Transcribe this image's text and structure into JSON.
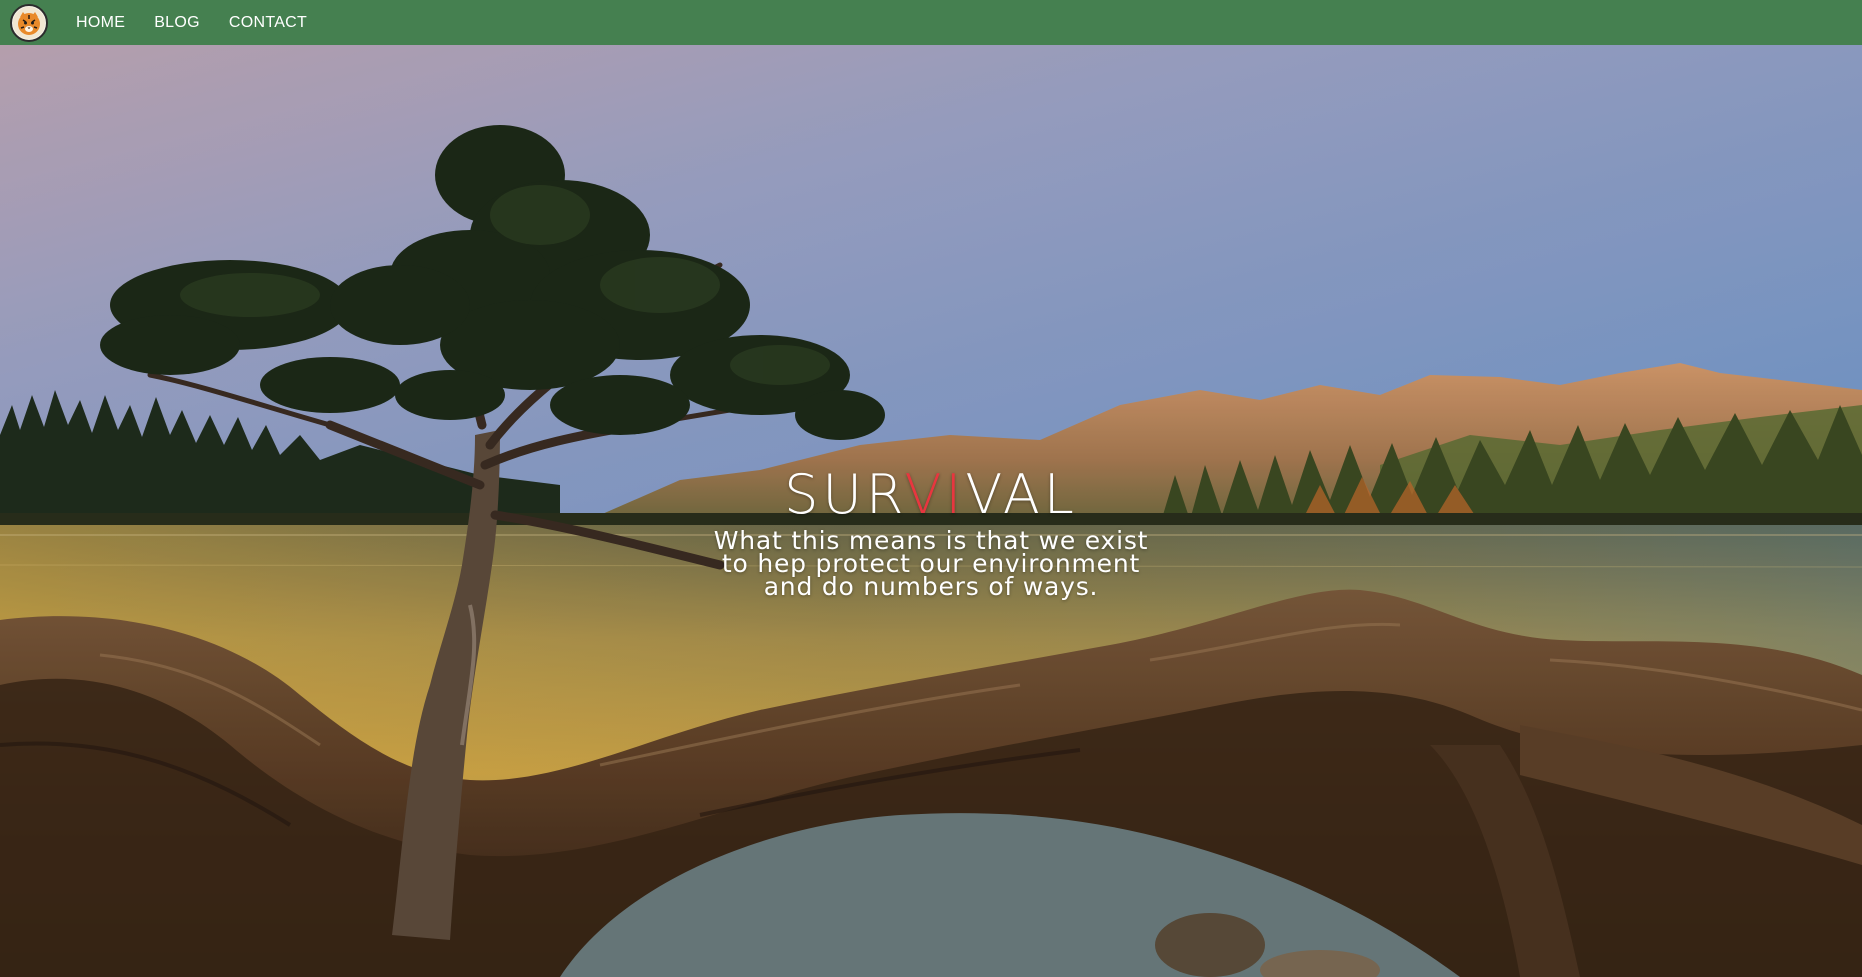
{
  "nav": {
    "logo_icon": "tiger-icon",
    "items": [
      {
        "label": "HOME"
      },
      {
        "label": "BLOG"
      },
      {
        "label": "CONTACT"
      }
    ],
    "background": "#458050"
  },
  "hero": {
    "title_part1": "SUR",
    "title_accent": "VI",
    "title_part2": "VAL",
    "subtitle": "What this means is that we exist to hep protect our environment and do numbers of ways.",
    "accent_color": "#e8363f"
  }
}
